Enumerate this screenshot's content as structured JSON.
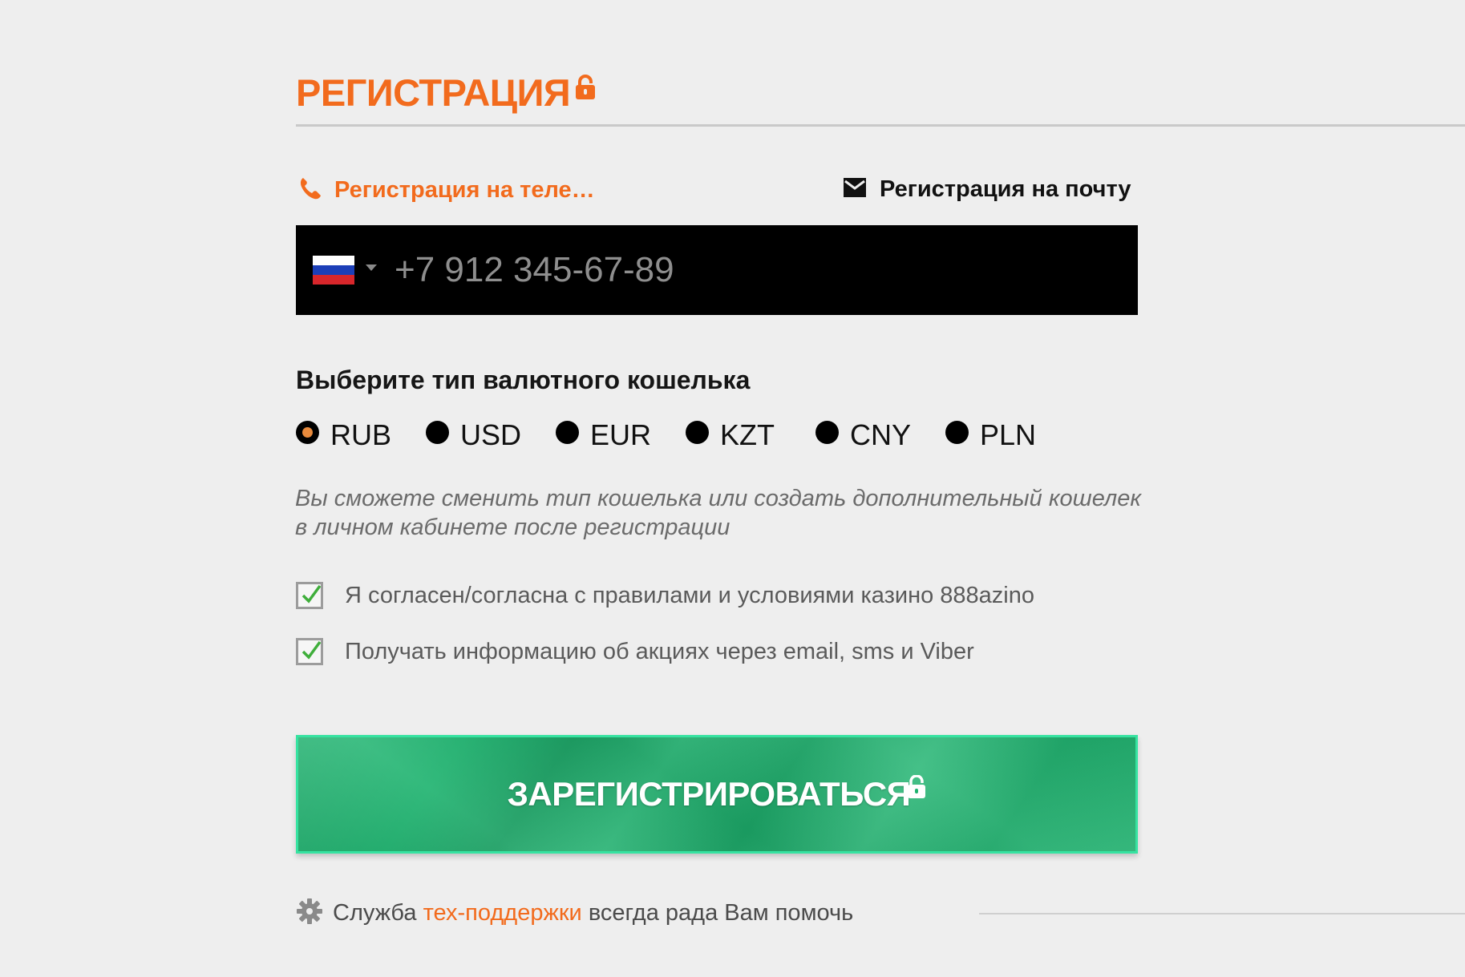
{
  "header": {
    "title": "РЕГИСТРАЦИЯ",
    "title_icon": "lock-icon"
  },
  "tabs": {
    "phone": {
      "label": "Регистрация на теле…",
      "icon": "phone-icon",
      "active": true
    },
    "email": {
      "label": "Регистрация на почту",
      "icon": "envelope-icon",
      "active": false
    }
  },
  "phone_input": {
    "country_flag": "russia-flag",
    "placeholder": "+7 912 345-67-89",
    "value": ""
  },
  "wallet": {
    "heading": "Выберите тип валютного кошелька",
    "currencies": [
      {
        "code": "RUB",
        "selected": true
      },
      {
        "code": "USD",
        "selected": false
      },
      {
        "code": "EUR",
        "selected": false
      },
      {
        "code": "KZT",
        "selected": false
      },
      {
        "code": "CNY",
        "selected": false
      },
      {
        "code": "PLN",
        "selected": false
      }
    ],
    "note": "Вы сможете сменить тип кошелька или создать дополнительный кошелек в личном кабинете после регистрации"
  },
  "agreements": [
    {
      "label": "Я согласен/согласна с правилами и условиями казино 888azino",
      "checked": true
    },
    {
      "label": "Получать информацию об акциях через email, sms и Viber",
      "checked": true
    }
  ],
  "register_button": {
    "label": "ЗАРЕГИСТРИРОВАТЬСЯ",
    "icon": "lock-icon"
  },
  "support": {
    "prefix": "Служба",
    "link": "тех-поддержки",
    "suffix": "всегда рада Вам помочь",
    "icon": "gear-icon"
  },
  "colors": {
    "accent": "#f26b1d",
    "background": "#eeeeee",
    "button_green": "#1eb36f",
    "button_border": "#36e3a1",
    "radio_selected": "#e88a3c"
  }
}
